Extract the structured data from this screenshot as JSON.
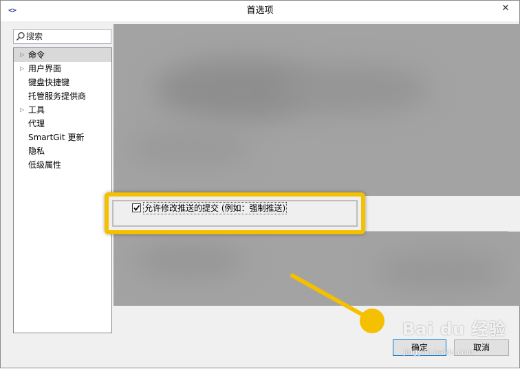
{
  "window": {
    "title": "首选项",
    "app_icon": "<>",
    "close_glyph": "✕"
  },
  "search": {
    "placeholder": "搜索"
  },
  "tree": {
    "items": [
      {
        "label": "命令",
        "expandable": true,
        "selected": true
      },
      {
        "label": "用户界面",
        "expandable": true,
        "selected": false
      },
      {
        "label": "键盘快捷键",
        "expandable": false,
        "selected": false
      },
      {
        "label": "托管服务提供商",
        "expandable": false,
        "selected": false
      },
      {
        "label": "工具",
        "expandable": true,
        "selected": false
      },
      {
        "label": "代理",
        "expandable": false,
        "selected": false
      },
      {
        "label": "SmartGit 更新",
        "expandable": false,
        "selected": false
      },
      {
        "label": "隐私",
        "expandable": false,
        "selected": false
      },
      {
        "label": "低级属性",
        "expandable": false,
        "selected": false
      }
    ]
  },
  "option": {
    "label": "允许修改推送的提交 (例如：强制推送)",
    "checked": true
  },
  "buttons": {
    "ok": "确定",
    "cancel": "取消"
  },
  "watermark": {
    "brand": "Bai du 经验",
    "sub": "jingyan.baidu.com"
  },
  "colors": {
    "highlight": "#f5c000",
    "accent": "#0078d7",
    "blur_area": "#a3a3a3"
  },
  "icons": {
    "search": "magnifier-icon",
    "expand": "triangle-right-icon",
    "check": "checkmark-icon"
  }
}
